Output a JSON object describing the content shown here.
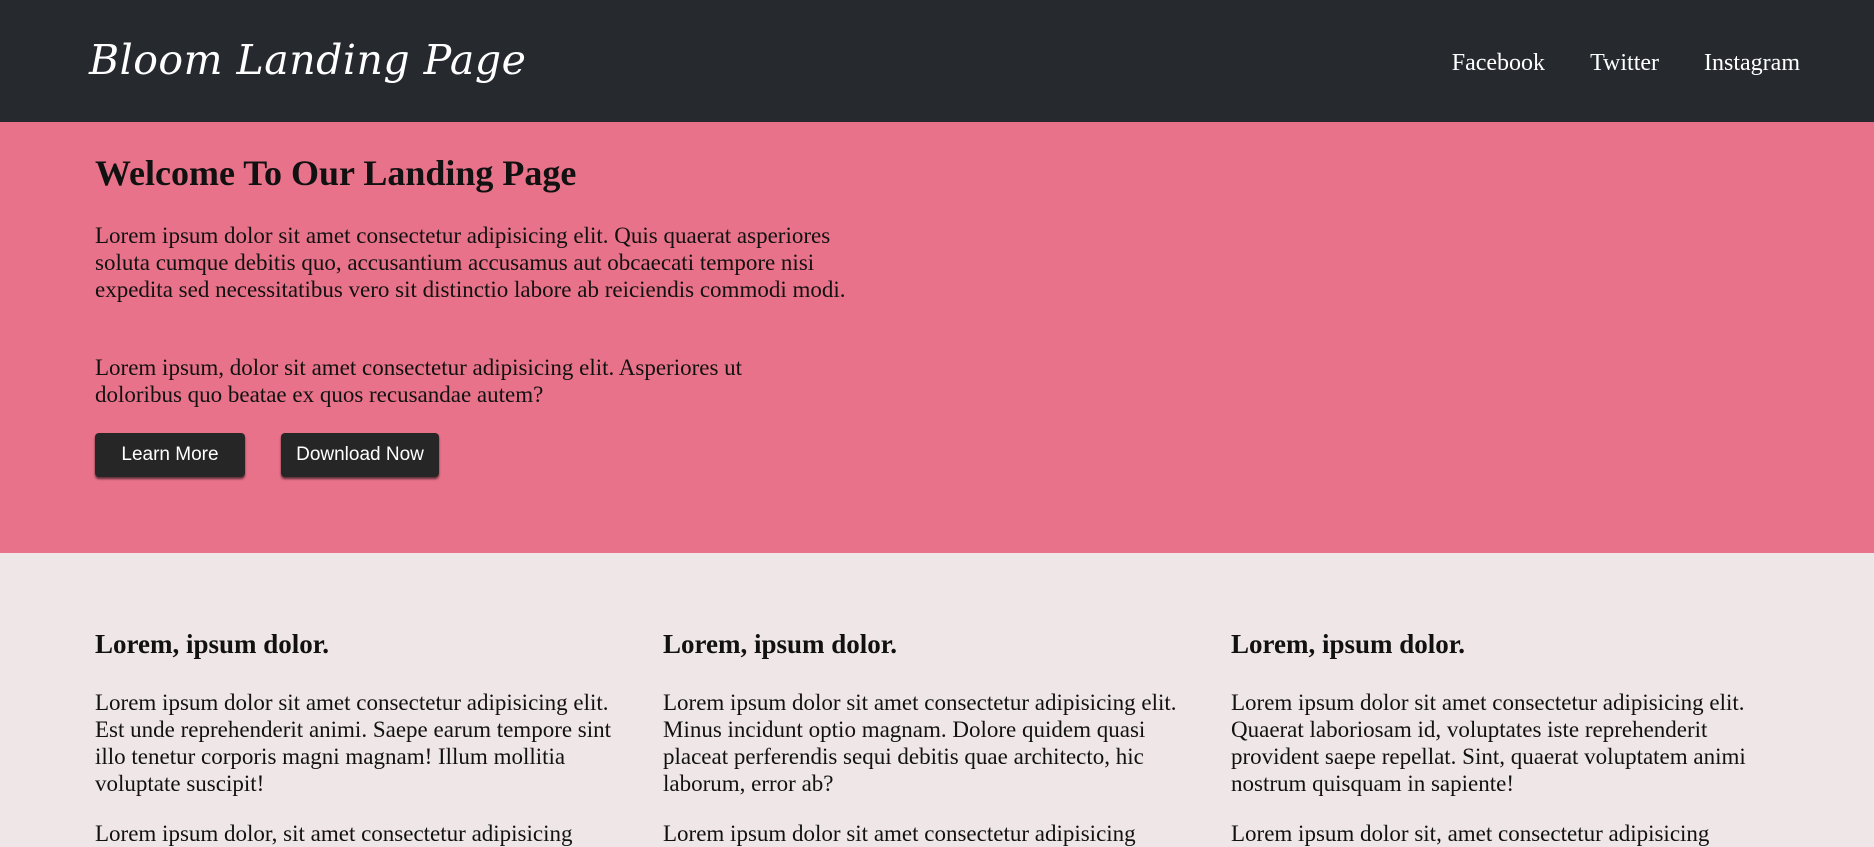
{
  "header": {
    "logo": "Bloom Landing Page",
    "nav": [
      "Facebook",
      "Twitter",
      "Instagram"
    ]
  },
  "hero": {
    "title": "Welcome To Our Landing Page",
    "paragraph1": "Lorem ipsum dolor sit amet consectetur adipisicing elit. Quis quaerat asperiores soluta cumque debitis quo, accusantium accusamus aut obcaecati tempore nisi expedita sed necessitatibus vero sit distinctio labore ab reiciendis commodi modi.",
    "paragraph2": "Lorem ipsum, dolor sit amet consectetur adipisicing elit. Asperiores ut doloribus quo beatae ex quos recusandae autem?",
    "learn_more": "Learn More",
    "download_now": "Download Now"
  },
  "features": [
    {
      "title": "Lorem, ipsum dolor.",
      "p1": "Lorem ipsum dolor sit amet consectetur adipisicing elit. Est unde reprehenderit animi. Saepe earum tempore sint illo tenetur corporis magni magnam! Illum mollitia voluptate suscipit!",
      "p2": "Lorem ipsum dolor, sit amet consectetur adipisicing"
    },
    {
      "title": "Lorem, ipsum dolor.",
      "p1": "Lorem ipsum dolor sit amet consectetur adipisicing elit. Minus incidunt optio magnam. Dolore quidem quasi placeat perferendis sequi debitis quae architecto, hic laborum, error ab?",
      "p2": "Lorem ipsum dolor sit amet consectetur adipisicing"
    },
    {
      "title": "Lorem, ipsum dolor.",
      "p1": "Lorem ipsum dolor sit amet consectetur adipisicing elit. Quaerat laboriosam id, voluptates iste reprehenderit provident saepe repellat. Sint, quaerat voluptatem animi nostrum quisquam in sapiente!",
      "p2": "Lorem ipsum dolor sit, amet consectetur adipisicing"
    }
  ],
  "colors": {
    "header_bg": "#262a2f",
    "hero_bg": "#e87289",
    "features_bg": "#efe6e7",
    "button_bg": "#262626"
  }
}
